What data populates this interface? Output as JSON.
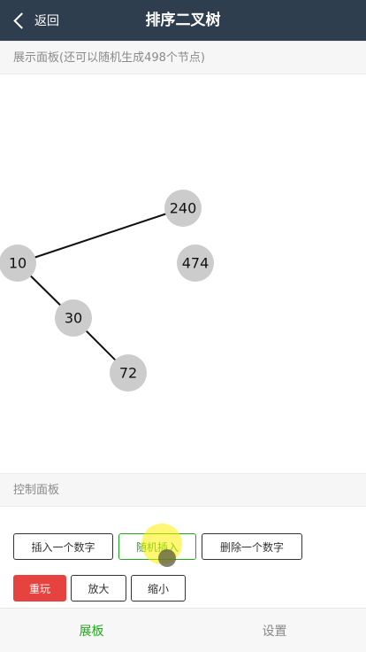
{
  "nav": {
    "back_label": "返回",
    "title": "排序二叉树"
  },
  "display_panel": {
    "header": "展示面板(还可以随机生成498个节点)"
  },
  "tree": {
    "nodes": [
      {
        "id": "n240",
        "label": "240"
      },
      {
        "id": "n10",
        "label": "10"
      },
      {
        "id": "n474",
        "label": "474"
      },
      {
        "id": "n30",
        "label": "30"
      },
      {
        "id": "n72",
        "label": "72"
      }
    ],
    "edges": [
      [
        "n240",
        "n10"
      ],
      [
        "n10",
        "n30"
      ],
      [
        "n30",
        "n72"
      ]
    ]
  },
  "control_panel": {
    "header": "控制面板",
    "buttons": {
      "insert": "插入一个数字",
      "random_insert": "随机插入",
      "delete": "删除一个数字",
      "replay": "重玩",
      "zoom_in": "放大",
      "zoom_out": "缩小"
    }
  },
  "tabs": {
    "board": "展板",
    "settings": "设置"
  },
  "colors": {
    "nav_bg": "#2f3e4e",
    "accent_green": "#1aad19",
    "accent_red": "#e64340",
    "node_fill": "#cccccc"
  }
}
